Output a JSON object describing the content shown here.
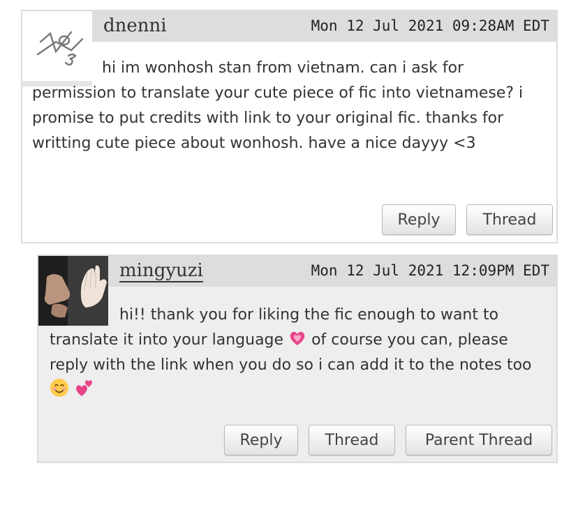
{
  "comments": [
    {
      "username": "dnenni",
      "timestamp": "Mon 12 Jul 2021 09:28AM EDT",
      "text": "hi im wonhosh stan from vietnam. can i ask for permission to translate your cute piece of fic into vietnamese? i promise to put credits with link to your original fic. thanks for writting cute piece about wonhosh. have a nice dayyy <3",
      "avatar": "default-avatar-icon",
      "actions": [
        "Reply",
        "Thread"
      ]
    },
    {
      "username": "mingyuzi",
      "timestamp": "Mon 12 Jul 2021 12:09PM EDT",
      "text_parts": [
        "hi!! thank you for liking the fic enough to want to translate it into your language",
        "of course you can, please reply with the link when you do so i can add it to the notes too"
      ],
      "emojis": [
        "growing-heart-emoji",
        "smiling-face-emoji",
        "two-hearts-emoji"
      ],
      "avatar": "user-photo-hands",
      "actions": [
        "Reply",
        "Thread",
        "Parent Thread"
      ]
    }
  ],
  "colors": {
    "header_bg": "#dddddd",
    "reply_bg": "#eeeeee",
    "border": "#dcdcdc",
    "heart": "#e8458a"
  }
}
